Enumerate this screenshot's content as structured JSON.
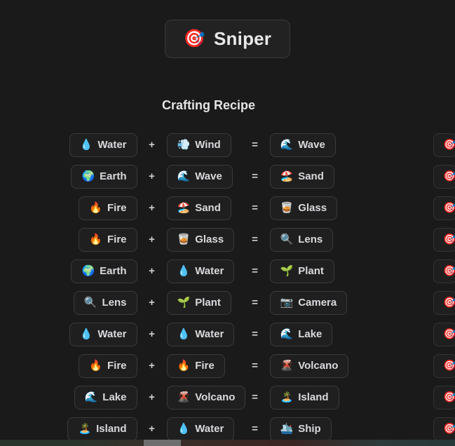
{
  "header": {
    "icon": "dart-icon",
    "icon_glyph": "🎯",
    "title": "Sniper"
  },
  "section": {
    "heading": "Crafting Recipe"
  },
  "operators": {
    "plus": "+",
    "equals": "="
  },
  "recipes": [
    {
      "a_glyph": "💧",
      "a_label": "Water",
      "a_icon": "water-droplet-icon",
      "b_glyph": "💨",
      "b_label": "Wind",
      "b_icon": "wind-dash-icon",
      "r_glyph": "🌊",
      "r_label": "Wave",
      "r_icon": "wave-icon"
    },
    {
      "a_glyph": "🌍",
      "a_label": "Earth",
      "a_icon": "earth-globe-icon",
      "b_glyph": "🌊",
      "b_label": "Wave",
      "b_icon": "wave-icon",
      "r_glyph": "🏖️",
      "r_label": "Sand",
      "r_icon": "beach-icon"
    },
    {
      "a_glyph": "🔥",
      "a_label": "Fire",
      "a_icon": "fire-icon",
      "b_glyph": "🏖️",
      "b_label": "Sand",
      "b_icon": "beach-icon",
      "r_glyph": "🥃",
      "r_label": "Glass",
      "r_icon": "glass-icon"
    },
    {
      "a_glyph": "🔥",
      "a_label": "Fire",
      "a_icon": "fire-icon",
      "b_glyph": "🥃",
      "b_label": "Glass",
      "b_icon": "glass-icon",
      "r_glyph": "🔍",
      "r_label": "Lens",
      "r_icon": "magnifier-icon"
    },
    {
      "a_glyph": "🌍",
      "a_label": "Earth",
      "a_icon": "earth-globe-icon",
      "b_glyph": "💧",
      "b_label": "Water",
      "b_icon": "water-droplet-icon",
      "r_glyph": "🌱",
      "r_label": "Plant",
      "r_icon": "seedling-icon"
    },
    {
      "a_glyph": "🔍",
      "a_label": "Lens",
      "a_icon": "magnifier-icon",
      "b_glyph": "🌱",
      "b_label": "Plant",
      "b_icon": "seedling-icon",
      "r_glyph": "📷",
      "r_label": "Camera",
      "r_icon": "camera-icon"
    },
    {
      "a_glyph": "💧",
      "a_label": "Water",
      "a_icon": "water-droplet-icon",
      "b_glyph": "💧",
      "b_label": "Water",
      "b_icon": "water-droplet-icon",
      "r_glyph": "🌊",
      "r_label": "Lake",
      "r_icon": "wave-icon"
    },
    {
      "a_glyph": "🔥",
      "a_label": "Fire",
      "a_icon": "fire-icon",
      "b_glyph": "🔥",
      "b_label": "Fire",
      "b_icon": "fire-icon",
      "r_glyph": "🌋",
      "r_label": "Volcano",
      "r_icon": "volcano-icon"
    },
    {
      "a_glyph": "🌊",
      "a_label": "Lake",
      "a_icon": "wave-icon",
      "b_glyph": "🌋",
      "b_label": "Volcano",
      "b_icon": "volcano-icon",
      "r_glyph": "🏝️",
      "r_label": "Island",
      "r_icon": "island-icon"
    },
    {
      "a_glyph": "🏝️",
      "a_label": "Island",
      "a_icon": "island-icon",
      "b_glyph": "💧",
      "b_label": "Water",
      "b_icon": "water-droplet-icon",
      "r_glyph": "🛳️",
      "r_label": "Ship",
      "r_icon": "ship-icon"
    }
  ],
  "edge_column": {
    "glyph": "🎯",
    "icon": "dart-icon",
    "count": 10
  },
  "colors": {
    "background": "#1a1a1a",
    "chip_background": "#1f1f1f",
    "chip_border": "#3b3b3b",
    "text": "#d9dade",
    "scrollbar_thumb": "#6e6e6e"
  }
}
